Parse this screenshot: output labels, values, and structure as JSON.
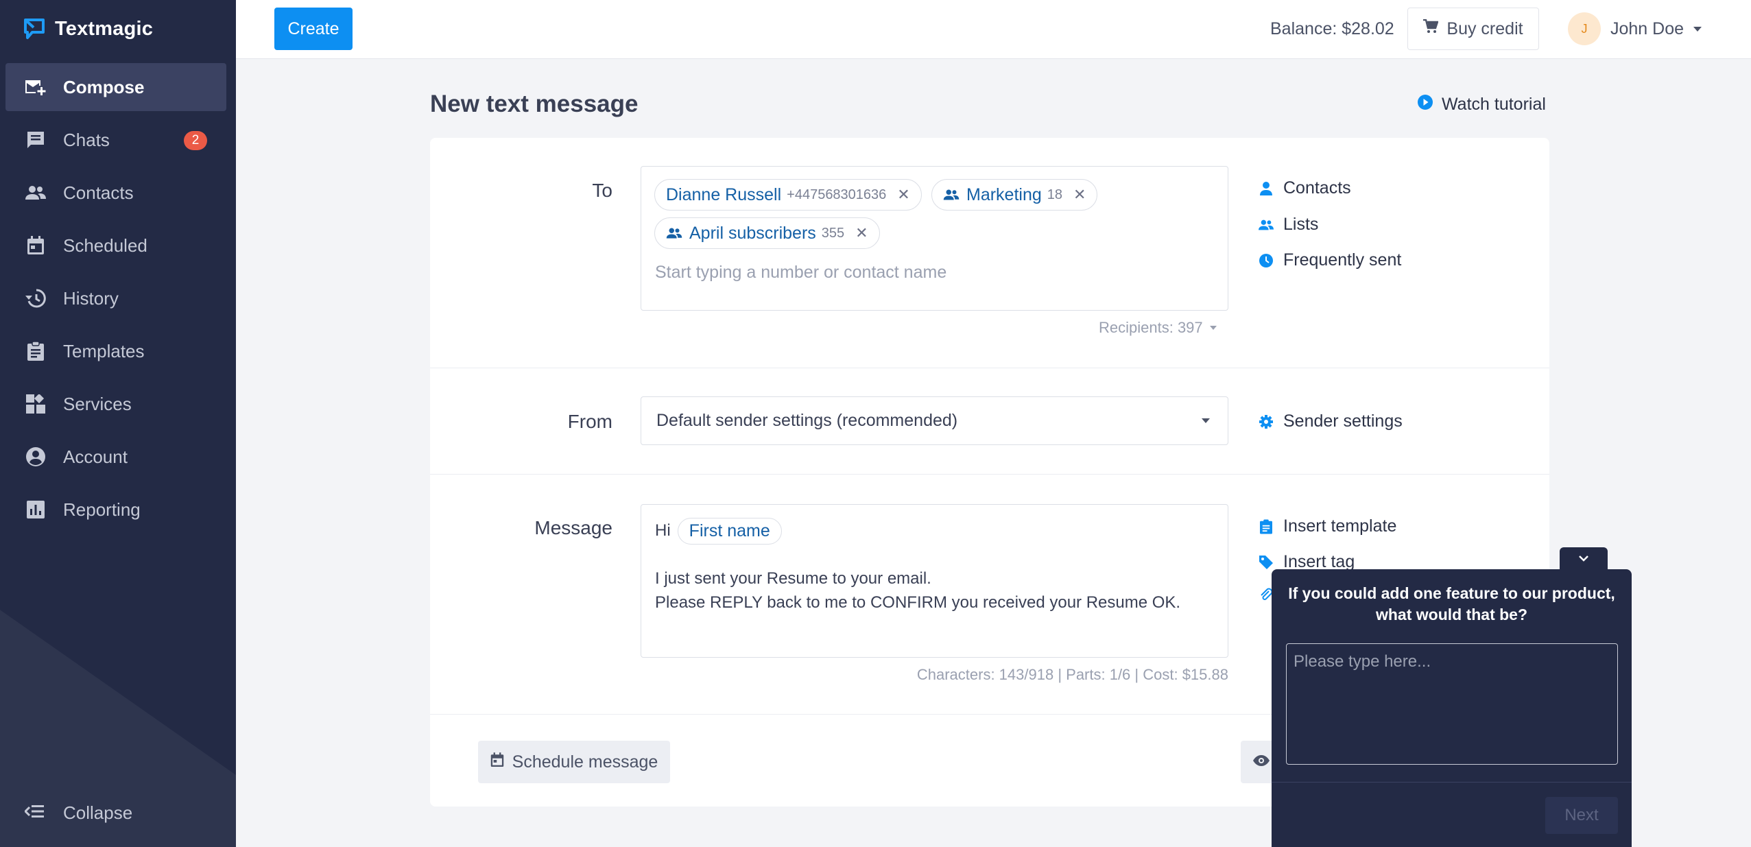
{
  "app": {
    "name": "Textmagic"
  },
  "sidebar": {
    "items": [
      {
        "label": "Compose",
        "icon": "compose-icon",
        "active": true
      },
      {
        "label": "Chats",
        "icon": "chat-icon",
        "badge": "2"
      },
      {
        "label": "Contacts",
        "icon": "contacts-icon"
      },
      {
        "label": "Scheduled",
        "icon": "calendar-icon"
      },
      {
        "label": "History",
        "icon": "history-icon"
      },
      {
        "label": "Templates",
        "icon": "clipboard-icon"
      },
      {
        "label": "Services",
        "icon": "services-icon"
      },
      {
        "label": "Account",
        "icon": "account-icon"
      },
      {
        "label": "Reporting",
        "icon": "reporting-icon"
      }
    ],
    "collapse_label": "Collapse"
  },
  "topbar": {
    "create_label": "Create",
    "balance": "Balance: $28.02",
    "buy_credit_label": "Buy credit",
    "user_initial": "J",
    "user_name": "John Doe"
  },
  "page": {
    "title": "New text message",
    "watch_tutorial": "Watch tutorial"
  },
  "compose": {
    "to_label": "To",
    "recipients_chips": [
      {
        "name": "Dianne Russell",
        "detail": "+447568301636",
        "type": "contact"
      },
      {
        "name": "Marketing",
        "detail": "18",
        "type": "list"
      },
      {
        "name": "April subscribers",
        "detail": "355",
        "type": "list"
      }
    ],
    "to_placeholder": "Start typing a number or contact name",
    "recipients_count": "Recipients: 397",
    "to_links": [
      "Contacts",
      "Lists",
      "Frequently sent"
    ],
    "from_label": "From",
    "from_value": "Default sender settings (recommended)",
    "sender_settings": "Sender settings",
    "message_label": "Message",
    "message_hi": "Hi",
    "message_tag": "First name",
    "message_line1": "I just sent your Resume to your email.",
    "message_line2": "Please REPLY back to me to CONFIRM you received your Resume OK.",
    "counts": "Characters: 143/918 | Parts: 1/6 | Cost: $15.88",
    "message_links": [
      "Insert template",
      "Insert tag"
    ],
    "schedule_label": "Schedule message"
  },
  "survey": {
    "question": "If you could add one feature to our product, what would that be?",
    "placeholder": "Please type here...",
    "next_label": "Next"
  },
  "colors": {
    "sidebar_bg": "#232a45",
    "accent": "#0d8ff2",
    "chip_text": "#1560a6",
    "badge": "#eb5a46"
  }
}
